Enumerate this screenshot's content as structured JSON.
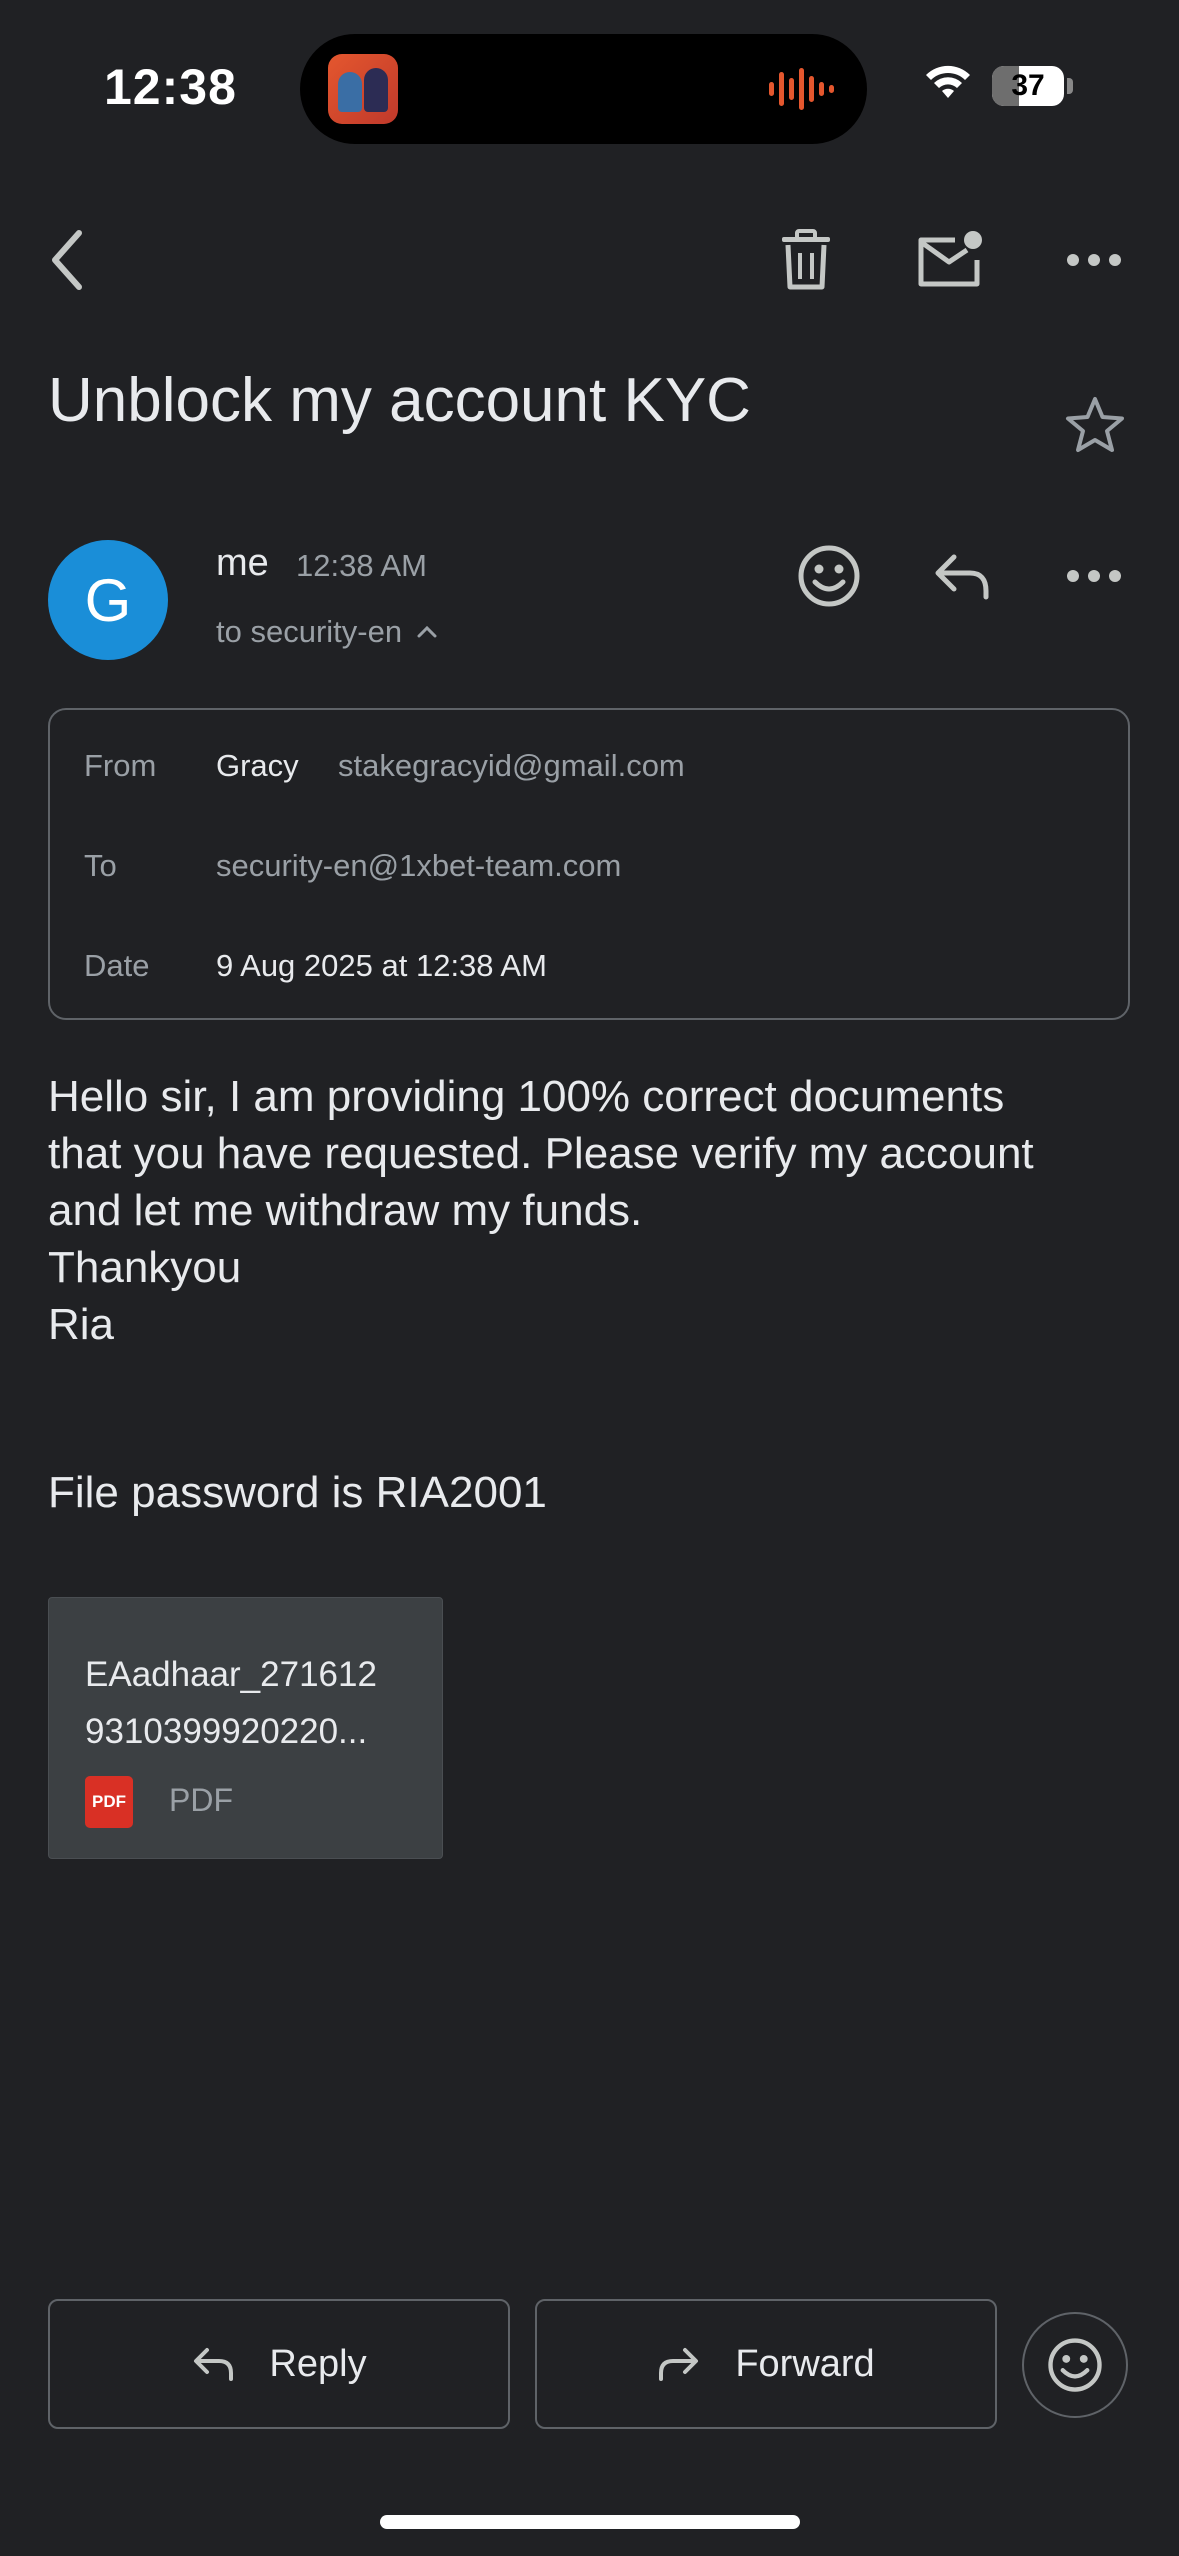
{
  "status_bar": {
    "time": "12:38",
    "battery_level": "37",
    "battery_fraction": 0.37
  },
  "toolbar": {
    "back_icon": "chevron-left-icon",
    "delete_icon": "trash-icon",
    "mark_unread_icon": "mail-unread-icon",
    "more_icon": "more-horizontal-icon"
  },
  "email": {
    "subject": "Unblock my account KYC",
    "avatar_letter": "G",
    "sender_display": "me",
    "time": "12:38 AM",
    "to_summary": "to security-en",
    "details": {
      "from_label": "From",
      "from_name": "Gracy",
      "from_email": "stakegracyid@gmail.com",
      "to_label": "To",
      "to_value": "security-en@1xbet-team.com",
      "date_label": "Date",
      "date_value": "9 Aug 2025 at 12:38 AM"
    },
    "body": "Hello sir, I am providing 100% correct documents\nthat you have requested. Please verify my account\nand let me withdraw my funds.\nThankyou\nRia",
    "password_line": "File password is RIA2001",
    "attachment": {
      "name": "EAadhaar_271612\n9310399920220...",
      "badge": "PDF",
      "type": "PDF"
    }
  },
  "actions": {
    "reply": "Reply",
    "forward": "Forward"
  },
  "colors": {
    "background": "#202124",
    "avatar": "#1a8ed8",
    "pdf_red": "#d93025",
    "island_wave": "#e4572e"
  }
}
